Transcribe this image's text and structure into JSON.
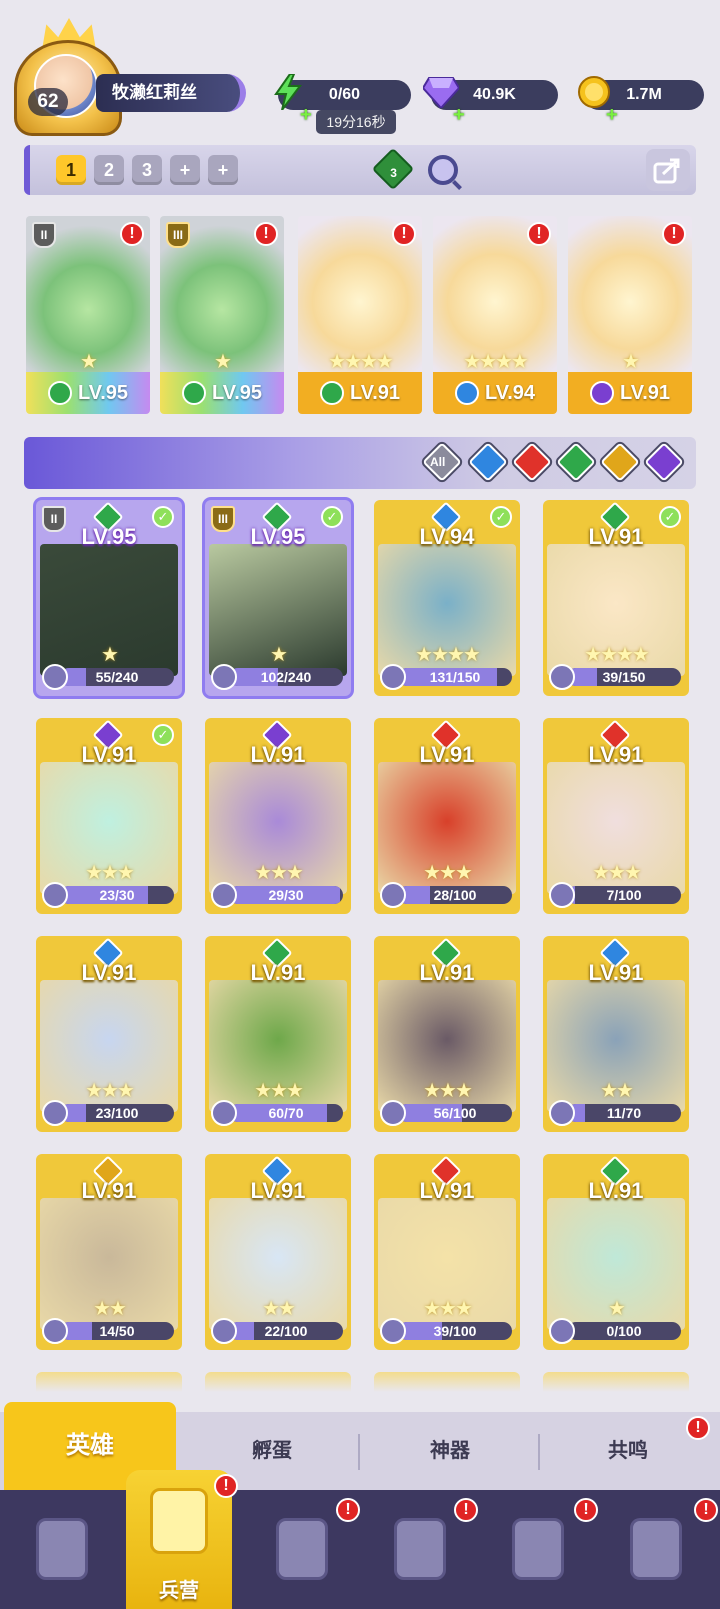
{
  "player": {
    "level": "62",
    "name": "牧濑红莉丝"
  },
  "resources": {
    "energy": "0/60",
    "energy_timer": "19分16秒",
    "gems": "40.9K",
    "coins": "1.7M"
  },
  "team_bar": {
    "tabs": [
      "1",
      "2",
      "3",
      "+",
      "+"
    ],
    "active_tab": "1",
    "gem_count": "3"
  },
  "team": [
    {
      "level": "LV.95",
      "element": "green",
      "rank": "II",
      "stars": "★",
      "bg": "rainbow"
    },
    {
      "level": "LV.95",
      "element": "green",
      "rank": "III",
      "stars": "★",
      "bg": "rainbow"
    },
    {
      "level": "LV.91",
      "element": "green",
      "rank": "",
      "stars": "★★★★",
      "bg": "gold"
    },
    {
      "level": "LV.94",
      "element": "blue",
      "rank": "",
      "stars": "★★★★",
      "bg": "gold"
    },
    {
      "level": "LV.91",
      "element": "purple",
      "rank": "",
      "stars": "★",
      "bg": "gold"
    }
  ],
  "filter": {
    "all_label": "All",
    "elements": [
      "blue",
      "red",
      "green",
      "yellow",
      "purple"
    ]
  },
  "heroes": [
    {
      "level": "LV.95",
      "element": "green",
      "progress": "55/240",
      "fraction": 0.23,
      "check": true,
      "rank": "II",
      "stars": "★",
      "style": "purple"
    },
    {
      "level": "LV.95",
      "element": "green",
      "progress": "102/240",
      "fraction": 0.43,
      "check": true,
      "rank": "III",
      "stars": "★",
      "style": "purple"
    },
    {
      "level": "LV.94",
      "element": "blue",
      "progress": "131/150",
      "fraction": 0.87,
      "check": true,
      "rank": "",
      "stars": "★★★★",
      "style": "gold"
    },
    {
      "level": "LV.91",
      "element": "green",
      "progress": "39/150",
      "fraction": 0.26,
      "check": true,
      "rank": "",
      "stars": "★★★★",
      "style": "gold"
    },
    {
      "level": "LV.91",
      "element": "purple",
      "progress": "23/30",
      "fraction": 0.77,
      "check": true,
      "rank": "",
      "stars": "★★★",
      "style": "gold"
    },
    {
      "level": "LV.91",
      "element": "purple",
      "progress": "29/30",
      "fraction": 0.97,
      "check": false,
      "rank": "",
      "stars": "★★★",
      "style": "gold"
    },
    {
      "level": "LV.91",
      "element": "red",
      "progress": "28/100",
      "fraction": 0.28,
      "check": false,
      "rank": "",
      "stars": "★★★",
      "style": "gold"
    },
    {
      "level": "LV.91",
      "element": "red",
      "progress": "7/100",
      "fraction": 0.07,
      "check": false,
      "rank": "",
      "stars": "★★★",
      "style": "gold"
    },
    {
      "level": "LV.91",
      "element": "blue",
      "progress": "23/100",
      "fraction": 0.23,
      "check": false,
      "rank": "",
      "stars": "★★★",
      "style": "gold"
    },
    {
      "level": "LV.91",
      "element": "green",
      "progress": "60/70",
      "fraction": 0.86,
      "check": false,
      "rank": "",
      "stars": "★★★",
      "style": "gold"
    },
    {
      "level": "LV.91",
      "element": "green",
      "progress": "56/100",
      "fraction": 0.56,
      "check": false,
      "rank": "",
      "stars": "★★★",
      "style": "gold"
    },
    {
      "level": "LV.91",
      "element": "blue",
      "progress": "11/70",
      "fraction": 0.16,
      "check": false,
      "rank": "",
      "stars": "★★",
      "style": "gold"
    },
    {
      "level": "LV.91",
      "element": "yellow",
      "progress": "14/50",
      "fraction": 0.28,
      "check": false,
      "rank": "",
      "stars": "★★",
      "style": "gold"
    },
    {
      "level": "LV.91",
      "element": "blue",
      "progress": "22/100",
      "fraction": 0.22,
      "check": false,
      "rank": "",
      "stars": "★★",
      "style": "gold"
    },
    {
      "level": "LV.91",
      "element": "red",
      "progress": "39/100",
      "fraction": 0.39,
      "check": false,
      "rank": "",
      "stars": "★★★",
      "style": "gold"
    },
    {
      "level": "LV.91",
      "element": "green",
      "progress": "0/100",
      "fraction": 0.0,
      "check": false,
      "rank": "",
      "stars": "★",
      "style": "gold"
    }
  ],
  "tabs": {
    "heroes": "英雄",
    "hatch": "孵蛋",
    "artifacts": "神器",
    "resonance": "共鸣"
  },
  "nav": {
    "barracks": "兵营"
  },
  "colors": {
    "green": "#2fa84a",
    "blue": "#2f86e0",
    "red": "#e0322a",
    "yellow": "#e0a61a",
    "purple": "#7a3fd0",
    "accent": "#f7c61b"
  }
}
